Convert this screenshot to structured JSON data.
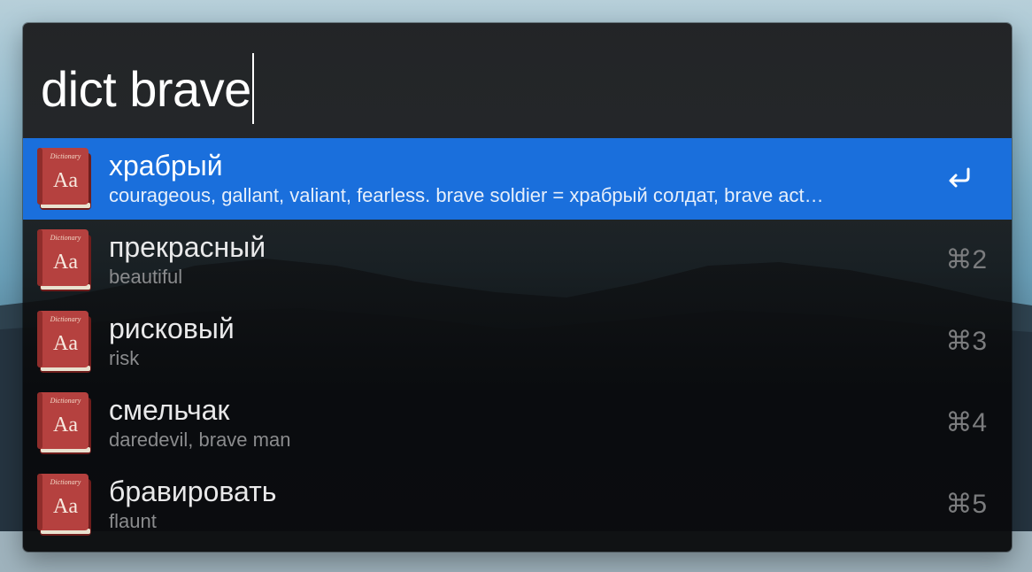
{
  "search": {
    "query": "dict brave"
  },
  "results": [
    {
      "title": "храбрый",
      "subtitle": "courageous, gallant, valiant, fearless. brave soldier = храбрый солдат, brave act…",
      "shortcut": "",
      "selected": true,
      "icon": "dictionary-icon",
      "action_icon": "return-icon"
    },
    {
      "title": "прекрасный",
      "subtitle": "beautiful",
      "shortcut": "⌘2",
      "selected": false,
      "icon": "dictionary-icon"
    },
    {
      "title": "рисковый",
      "subtitle": "risk",
      "shortcut": "⌘3",
      "selected": false,
      "icon": "dictionary-icon"
    },
    {
      "title": "смельчак",
      "subtitle": "daredevil, brave man",
      "shortcut": "⌘4",
      "selected": false,
      "icon": "dictionary-icon"
    },
    {
      "title": "бравировать",
      "subtitle": "flaunt",
      "shortcut": "⌘5",
      "selected": false,
      "icon": "dictionary-icon"
    }
  ],
  "dictionary_icon": {
    "cover_label": "Dictionary",
    "glyph": "Aa"
  },
  "colors": {
    "selection": "#1a6fdc",
    "panel": "#1e1f21",
    "book_cover": "#b5413f"
  }
}
